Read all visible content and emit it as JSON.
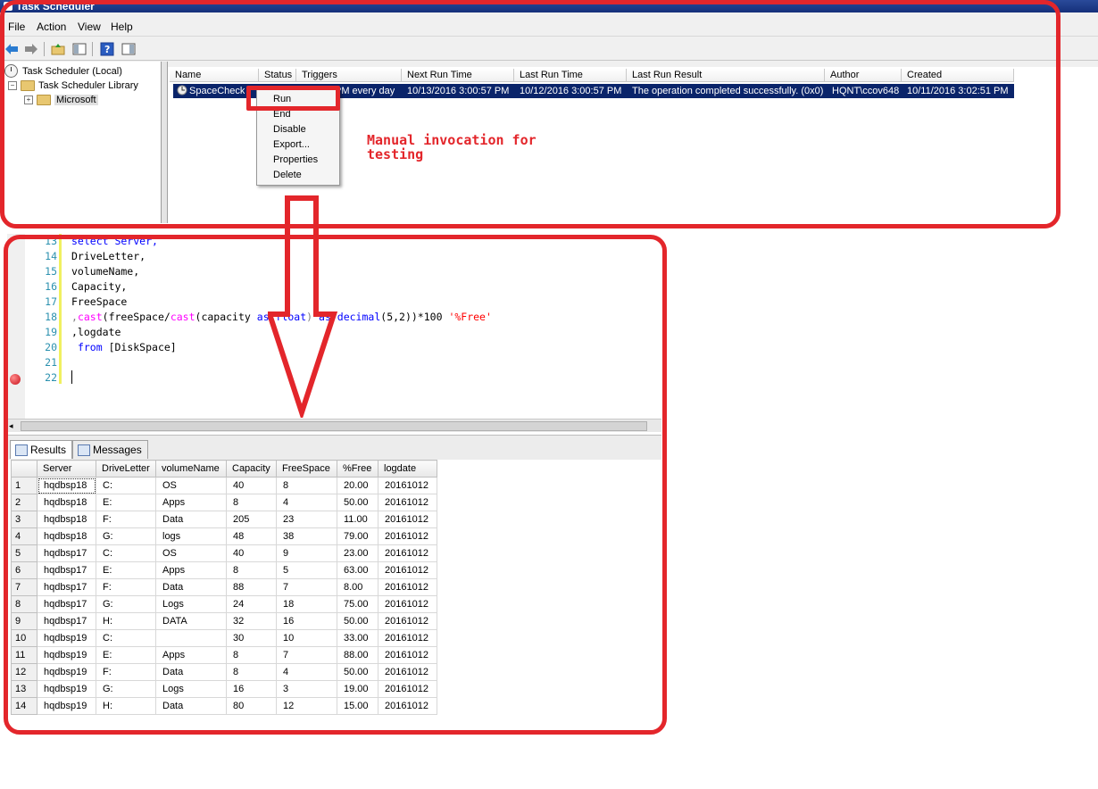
{
  "task_scheduler": {
    "window_title": "Task Scheduler",
    "menu": [
      "File",
      "Action",
      "View",
      "Help"
    ],
    "toolbar_icons": [
      "back-arrow-icon",
      "forward-arrow-icon",
      "up-folder-icon",
      "show-hide-tree-icon",
      "help-icon",
      "action-pane-icon"
    ],
    "tree": {
      "root": "Task Scheduler (Local)",
      "library": "Task Scheduler Library",
      "child": "Microsoft"
    },
    "columns": [
      "Name",
      "Status",
      "Triggers",
      "Next Run Time",
      "Last Run Time",
      "Last Run Result",
      "Author",
      "Created"
    ],
    "task": {
      "name": "SpaceCheck",
      "triggers_visible": "PM every day",
      "next_run_time": "10/13/2016 3:00:57 PM",
      "last_run_time": "10/12/2016 3:00:57 PM",
      "last_run_result": "The operation completed successfully. (0x0)",
      "author": "HQNT\\ccov648",
      "created": "10/11/2016 3:02:51 PM"
    },
    "context_menu": [
      "Run",
      "End",
      "Disable",
      "Export...",
      "Properties",
      "Delete"
    ],
    "annotation_line1": "Manual invocation for",
    "annotation_line2": "testing"
  },
  "sql_editor": {
    "line_numbers": [
      "13",
      "14",
      "15",
      "16",
      "17",
      "18",
      "19",
      "20",
      "21",
      "22"
    ],
    "code": {
      "l13": "select Server,",
      "l14": "DriveLetter,",
      "l15": "volumeName,",
      "l16": "Capacity,",
      "l17": "FreeSpace",
      "l18_a": ",",
      "l18_b": "cast",
      "l18_c": "(freeSpace/",
      "l18_d": "cast",
      "l18_e": "(capacity ",
      "l18_f": "as float",
      "l18_g": ") ",
      "l18_h": "as decimal",
      "l18_i": "(5,2))*100 ",
      "l18_j": "'%Free'",
      "l19": ",logdate",
      "l20_a": "from",
      "l20_b": " [DiskSpace]"
    }
  },
  "results": {
    "tabs": [
      "Results",
      "Messages"
    ],
    "columns": [
      "Server",
      "DriveLetter",
      "volumeName",
      "Capacity",
      "FreeSpace",
      "%Free",
      "logdate"
    ],
    "rows": [
      [
        "1",
        "hqdbsp18",
        "C:",
        "OS",
        "40",
        "8",
        "20.00",
        "20161012"
      ],
      [
        "2",
        "hqdbsp18",
        "E:",
        "Apps",
        "8",
        "4",
        "50.00",
        "20161012"
      ],
      [
        "3",
        "hqdbsp18",
        "F:",
        "Data",
        "205",
        "23",
        "11.00",
        "20161012"
      ],
      [
        "4",
        "hqdbsp18",
        "G:",
        "logs",
        "48",
        "38",
        "79.00",
        "20161012"
      ],
      [
        "5",
        "hqdbsp17",
        "C:",
        "OS",
        "40",
        "9",
        "23.00",
        "20161012"
      ],
      [
        "6",
        "hqdbsp17",
        "E:",
        "Apps",
        "8",
        "5",
        "63.00",
        "20161012"
      ],
      [
        "7",
        "hqdbsp17",
        "F:",
        "Data",
        "88",
        "7",
        "8.00",
        "20161012"
      ],
      [
        "8",
        "hqdbsp17",
        "G:",
        "Logs",
        "24",
        "18",
        "75.00",
        "20161012"
      ],
      [
        "9",
        "hqdbsp17",
        "H:",
        "DATA",
        "32",
        "16",
        "50.00",
        "20161012"
      ],
      [
        "10",
        "hqdbsp19",
        "C:",
        "",
        "30",
        "10",
        "33.00",
        "20161012"
      ],
      [
        "11",
        "hqdbsp19",
        "E:",
        "Apps",
        "8",
        "7",
        "88.00",
        "20161012"
      ],
      [
        "12",
        "hqdbsp19",
        "F:",
        "Data",
        "8",
        "4",
        "50.00",
        "20161012"
      ],
      [
        "13",
        "hqdbsp19",
        "G:",
        "Logs",
        "16",
        "3",
        "19.00",
        "20161012"
      ],
      [
        "14",
        "hqdbsp19",
        "H:",
        "Data",
        "80",
        "12",
        "15.00",
        "20161012"
      ]
    ]
  },
  "colors": {
    "annotation_red": "#e3262b",
    "selection_blue": "#0a246a"
  }
}
